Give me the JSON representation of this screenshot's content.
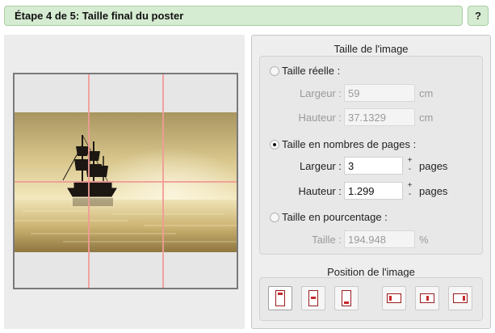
{
  "header": {
    "title": "Étape 4 de 5: Taille final du poster",
    "help_label": "?"
  },
  "image_size": {
    "title": "Taille de l'image",
    "options": [
      {
        "label": "Taille réelle :",
        "selected": false
      },
      {
        "label": "Taille en nombres de pages :",
        "selected": true
      },
      {
        "label": "Taille en pourcentage :",
        "selected": false
      }
    ],
    "real": {
      "width_label": "Largeur :",
      "width_value": "59",
      "height_label": "Hauteur :",
      "height_value": "37.1329",
      "unit": "cm"
    },
    "pages": {
      "width_label": "Largeur :",
      "width_value": "3",
      "height_label": "Hauteur :",
      "height_value": "1.299",
      "unit": "pages",
      "spin_up": "+",
      "spin_down": "-"
    },
    "percent": {
      "label": "Taille :",
      "value": "194.948",
      "unit": "%"
    }
  },
  "image_position": {
    "title": "Position de l'image",
    "buttons": [
      {
        "icon": "align-top-icon",
        "selected": true
      },
      {
        "icon": "align-middle-icon",
        "selected": false
      },
      {
        "icon": "align-bottom-icon",
        "selected": false
      },
      {
        "icon": "align-left-icon",
        "selected": false
      },
      {
        "icon": "align-center-icon",
        "selected": false
      },
      {
        "icon": "align-right-icon",
        "selected": false
      }
    ]
  },
  "preview": {
    "image": "sailing-ship-sunset",
    "grid": {
      "columns": 3,
      "rows": 2
    },
    "guide_color": "#f29a97"
  },
  "colors": {
    "header_bg": "#d6ecd2",
    "header_border": "#a9cda3",
    "accent_red": "#c62828"
  }
}
